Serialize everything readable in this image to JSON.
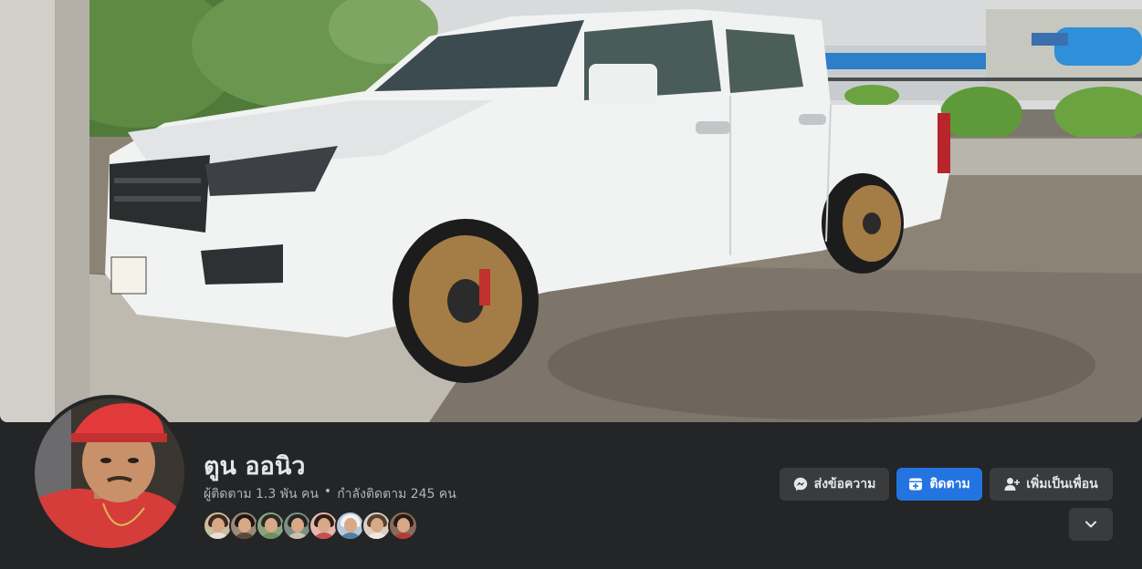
{
  "profile": {
    "name": "ตูน ออนิว",
    "followers_text": "ผู้ติดตาม 1.3 พัน คน",
    "separator": "•",
    "following_text": "กำลังติดตาม 245 คน"
  },
  "actions": {
    "message_label": "ส่งข้อความ",
    "follow_label": "ติดตาม",
    "add_friend_label": "เพิ่มเป็นเพื่อน"
  },
  "colors": {
    "page_bg": "#242526",
    "button_bg": "#3a3b3c",
    "primary": "#2374e1",
    "text_primary": "#e4e6eb",
    "text_secondary": "#b0b3b8"
  },
  "icons": {
    "message": "messenger-icon",
    "follow": "follow-plus-icon",
    "add_friend": "add-friend-icon",
    "more": "chevron-down-icon"
  }
}
